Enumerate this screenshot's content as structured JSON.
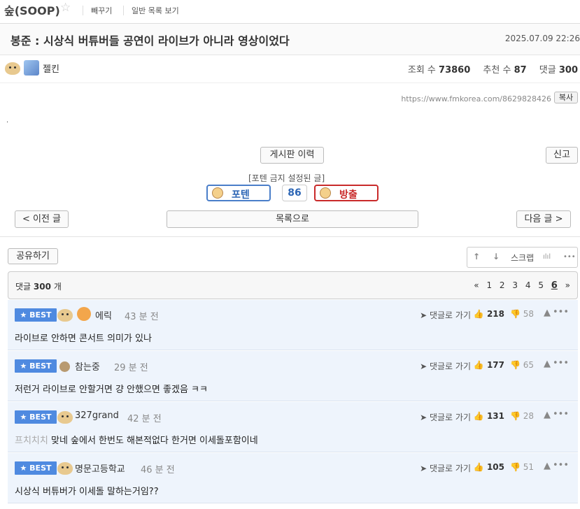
{
  "top": {
    "board_name": "숲(SOOP)",
    "star": "☆",
    "link1": "빼꾸기",
    "link2": "일반 목록 보기"
  },
  "post": {
    "title": "봉준 : 시상식 버튜버들 공연이 라이브가 아니라 영상이었다",
    "date": "2025.07.09 22:26",
    "author": "젤킨",
    "views_label": "조회 수",
    "views": "73860",
    "likes_label": "추천 수",
    "likes": "87",
    "comments_label": "댓글",
    "comments": "300",
    "url": "https://www.fmkorea.com/8629828426",
    "copy_label": "복사",
    "body": "."
  },
  "actions": {
    "history": "게시판 이력",
    "report": "신고",
    "ban_notice": "[포텐 금지 설정된 글]",
    "poten": "포텐",
    "vote_count": "86",
    "bangchul": "방출",
    "prev": "< 이전 글",
    "list": "목록으로",
    "next": "다음 글 >",
    "share": "공유하기",
    "up_icon": "↑",
    "down_icon": "↓",
    "scrap": "스크랩",
    "chart_icon": "ılıl",
    "more_icon": "•••"
  },
  "comments_header": {
    "label": "댓글",
    "count": "300",
    "unit": "개",
    "pager": {
      "prev": "«",
      "pages": [
        "1",
        "2",
        "3",
        "4",
        "5"
      ],
      "current": "6",
      "next": "»"
    }
  },
  "comment_labels": {
    "best": "★ BEST",
    "reply": "➤ 댓글로 가기",
    "thumb_up": "👍",
    "thumb_down": "👎",
    "warn": "▲",
    "more": "•••"
  },
  "comments": [
    {
      "name": "에릭",
      "time": "43 분 전",
      "up": "218",
      "down": "58",
      "body": "라이브로 안하면 콘서트 의미가 있나",
      "prefix": ""
    },
    {
      "name": "참는중",
      "time": "29 분 전",
      "up": "177",
      "down": "65",
      "body": "저런거 라이브로 안할거면 걍 안했으면 좋겠음 ㅋㅋ",
      "prefix": ""
    },
    {
      "name": "327grand",
      "time": "42 분 전",
      "up": "131",
      "down": "28",
      "body": "맞네 숲에서 한번도 해본적없다 한거면 이세돌포함이네",
      "prefix": "프치치치"
    },
    {
      "name": "명문고등학교",
      "time": "46 분 전",
      "up": "105",
      "down": "51",
      "body": "시상식 버튜버가 이세돌 말하는거임??",
      "prefix": ""
    }
  ]
}
